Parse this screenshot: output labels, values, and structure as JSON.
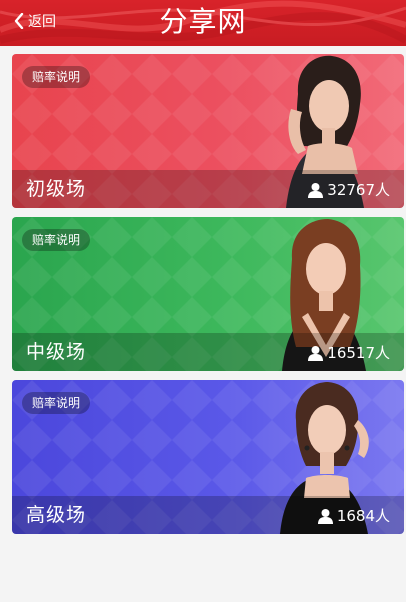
{
  "header": {
    "back_label": "返回",
    "title": "分享网",
    "color": "#d8232a"
  },
  "rooms": [
    {
      "name": "初级场",
      "odds_label": "赔率说明",
      "players": "32767人",
      "color": "#e8444e"
    },
    {
      "name": "中级场",
      "odds_label": "赔率说明",
      "players": "16517人",
      "color": "#2aa54e"
    },
    {
      "name": "高级场",
      "odds_label": "赔率说明",
      "players": "1684人",
      "color": "#4b47dc"
    }
  ],
  "icons": {
    "back": "chevron-left-icon",
    "players": "user-icon"
  }
}
